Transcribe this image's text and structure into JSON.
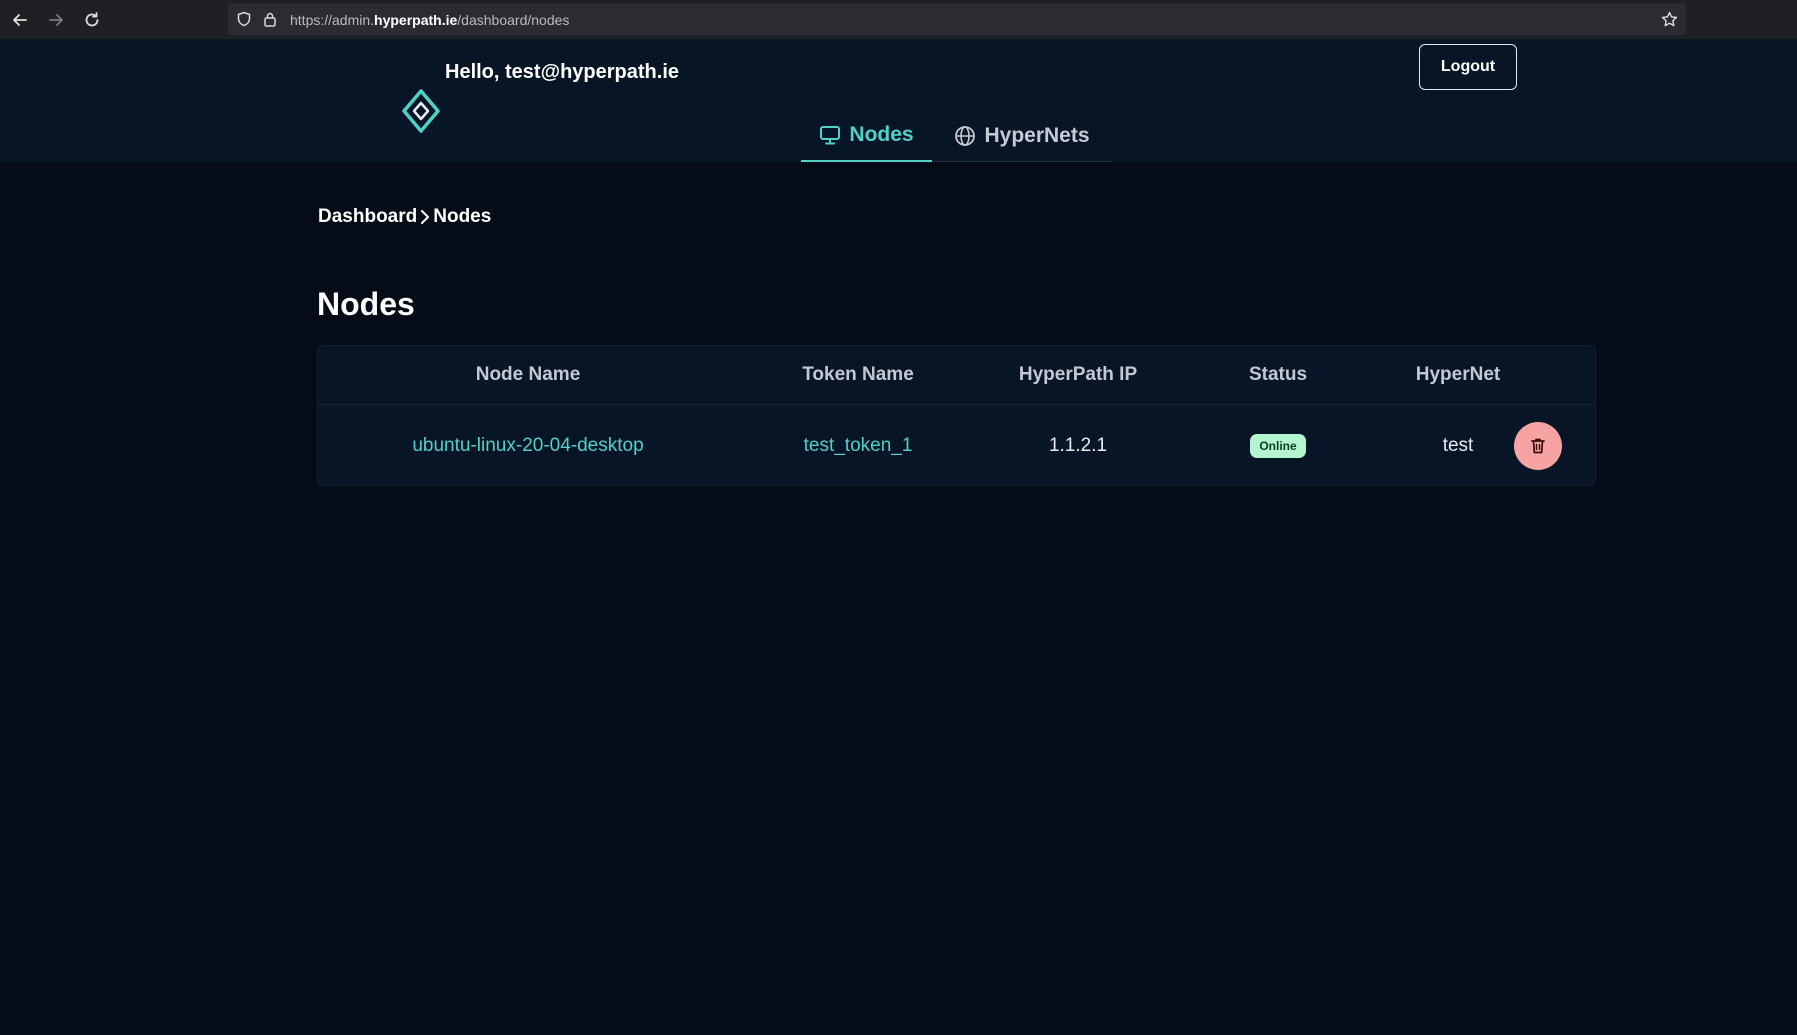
{
  "browser": {
    "url_prefix": "https://admin.",
    "url_host": "hyperpath.ie",
    "url_path": "/dashboard/nodes"
  },
  "header": {
    "greeting": "Hello, test@hyperpath.ie",
    "logout_label": "Logout",
    "accent_color": "#4fd1c5"
  },
  "tabs": [
    {
      "label": "Nodes",
      "icon": "monitor-icon",
      "active": true
    },
    {
      "label": "HyperNets",
      "icon": "globe-icon",
      "active": false
    }
  ],
  "breadcrumb": {
    "items": [
      "Dashboard",
      "Nodes"
    ]
  },
  "page": {
    "title": "Nodes"
  },
  "table": {
    "columns": [
      "Node Name",
      "Token Name",
      "HyperPath IP",
      "Status",
      "HyperNet"
    ],
    "rows": [
      {
        "node_name": "ubuntu-linux-20-04-desktop",
        "token_name": "test_token_1",
        "ip": "1.1.2.1",
        "status": "Online",
        "hypernet": "test"
      }
    ],
    "status_color": "#b3f5cf",
    "delete_color": "#f7a3a3"
  }
}
